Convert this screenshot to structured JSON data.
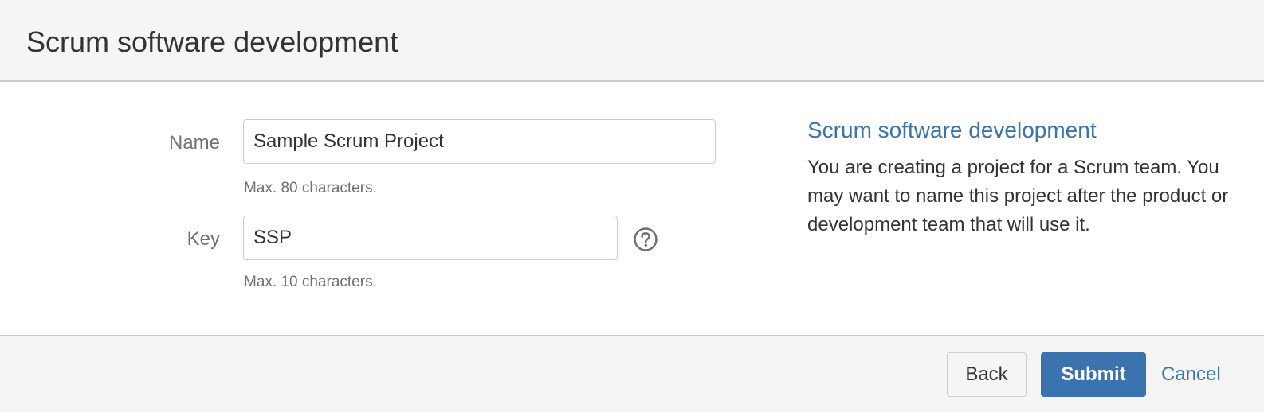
{
  "header": {
    "title": "Scrum software development"
  },
  "form": {
    "name": {
      "label": "Name",
      "value": "Sample Scrum Project",
      "hint": "Max. 80 characters."
    },
    "key": {
      "label": "Key",
      "value": "SSP",
      "hint": "Max. 10 characters.",
      "help_icon": "question-circle-icon"
    }
  },
  "info": {
    "title": "Scrum software development",
    "description": "You are creating a project for a Scrum team. You may want to name this project after the product or development team that will use it."
  },
  "footer": {
    "back_label": "Back",
    "submit_label": "Submit",
    "cancel_label": "Cancel"
  },
  "colors": {
    "accent": "#3b73af",
    "header_bg": "#f5f5f5",
    "label_gray": "#707070"
  }
}
